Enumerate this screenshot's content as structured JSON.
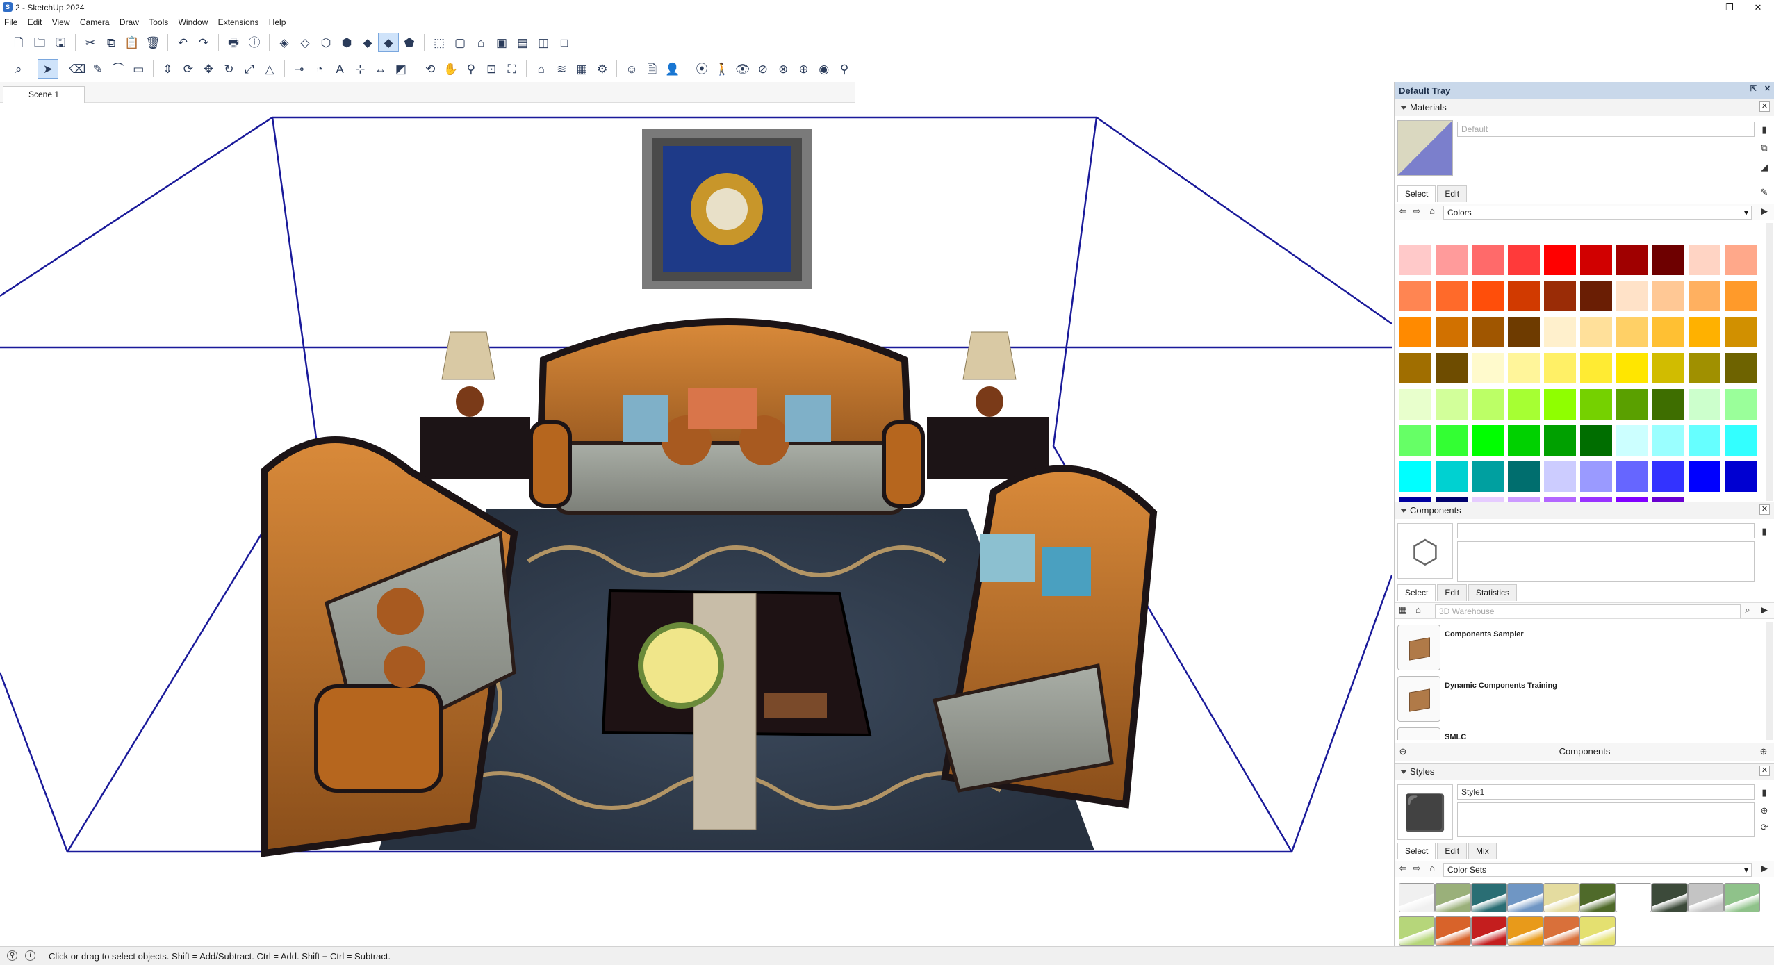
{
  "window": {
    "title": "2 - SketchUp 2024",
    "minimize": "—",
    "maximize": "❐",
    "close": "✕"
  },
  "menu": [
    "File",
    "Edit",
    "View",
    "Camera",
    "Draw",
    "Tools",
    "Window",
    "Extensions",
    "Help"
  ],
  "toolbar1": [
    {
      "name": "new-file-icon",
      "glyph": "🗋"
    },
    {
      "name": "open-icon",
      "glyph": "🗀"
    },
    {
      "name": "save-icon",
      "glyph": "🖫"
    },
    {
      "sep": true
    },
    {
      "name": "cut-icon",
      "glyph": "✂"
    },
    {
      "name": "copy-icon",
      "glyph": "⧉"
    },
    {
      "name": "paste-icon",
      "glyph": "📋"
    },
    {
      "name": "erase-icon",
      "glyph": "🗑"
    },
    {
      "sep": true
    },
    {
      "name": "undo-icon",
      "glyph": "↶"
    },
    {
      "name": "redo-icon",
      "glyph": "↷"
    },
    {
      "sep": true
    },
    {
      "name": "print-icon",
      "glyph": "🖶"
    },
    {
      "name": "model-info-icon",
      "glyph": "ⓘ"
    },
    {
      "sep": true
    },
    {
      "name": "xray-icon",
      "glyph": "◈"
    },
    {
      "name": "back-edges-icon",
      "glyph": "◇"
    },
    {
      "name": "wireframe-icon",
      "glyph": "⬡"
    },
    {
      "name": "hidden-line-icon",
      "glyph": "⬢"
    },
    {
      "name": "shaded-icon",
      "glyph": "◆"
    },
    {
      "name": "shaded-textures-icon",
      "glyph": "◆",
      "sel": true
    },
    {
      "name": "monochrome-icon",
      "glyph": "⬟"
    },
    {
      "sep": true
    },
    {
      "name": "iso-view-icon",
      "glyph": "⬚"
    },
    {
      "name": "top-view-icon",
      "glyph": "▢"
    },
    {
      "name": "front-view-icon",
      "glyph": "⌂"
    },
    {
      "name": "right-view-icon",
      "glyph": "▣"
    },
    {
      "name": "back-view-icon",
      "glyph": "▤"
    },
    {
      "name": "left-view-icon",
      "glyph": "◫"
    },
    {
      "name": "bottom-view-icon",
      "glyph": "□"
    }
  ],
  "toolbar2": [
    {
      "name": "search-icon",
      "glyph": "⌕"
    },
    {
      "sep": true
    },
    {
      "name": "select-tool-icon",
      "glyph": "➤",
      "sel": true
    },
    {
      "sep": true
    },
    {
      "name": "eraser-icon",
      "glyph": "⌫"
    },
    {
      "name": "line-tool-icon",
      "glyph": "✎"
    },
    {
      "name": "arc-tool-icon",
      "glyph": "⌒"
    },
    {
      "name": "rectangle-tool-icon",
      "glyph": "▭"
    },
    {
      "sep": true
    },
    {
      "name": "push-pull-icon",
      "glyph": "⇕"
    },
    {
      "name": "offset-icon",
      "glyph": "⟳"
    },
    {
      "name": "move-icon",
      "glyph": "✥"
    },
    {
      "name": "rotate-icon",
      "glyph": "↻"
    },
    {
      "name": "scale-icon",
      "glyph": "⤢"
    },
    {
      "name": "follow-me-icon",
      "glyph": "△"
    },
    {
      "sep": true
    },
    {
      "name": "tape-measure-icon",
      "glyph": "⊸"
    },
    {
      "name": "protractor-icon",
      "glyph": "◔"
    },
    {
      "name": "text-tool-icon",
      "glyph": "A"
    },
    {
      "name": "axes-icon",
      "glyph": "⊹"
    },
    {
      "name": "dimension-icon",
      "glyph": "↔"
    },
    {
      "name": "section-plane-icon",
      "glyph": "◩"
    },
    {
      "sep": true
    },
    {
      "name": "orbit-icon",
      "glyph": "⟲"
    },
    {
      "name": "pan-icon",
      "glyph": "✋"
    },
    {
      "name": "zoom-icon",
      "glyph": "⚲"
    },
    {
      "name": "zoom-window-icon",
      "glyph": "⊡"
    },
    {
      "name": "zoom-extents-icon",
      "glyph": "⛶"
    },
    {
      "sep": true
    },
    {
      "name": "3d-warehouse-icon",
      "glyph": "⌂"
    },
    {
      "name": "extension-warehouse-icon",
      "glyph": "≋"
    },
    {
      "name": "layout-icon",
      "glyph": "▦"
    },
    {
      "name": "trimble-connect-icon",
      "glyph": "⚙"
    },
    {
      "sep": true
    },
    {
      "name": "account-icon",
      "glyph": "☺"
    },
    {
      "name": "document-icon",
      "glyph": "🗎"
    },
    {
      "name": "user-icon",
      "glyph": "👤"
    },
    {
      "sep": true
    },
    {
      "name": "position-camera-icon",
      "glyph": "⦿"
    },
    {
      "name": "walk-icon",
      "glyph": "🚶"
    },
    {
      "name": "look-around-icon",
      "glyph": "👁"
    },
    {
      "name": "section-cut-icon",
      "glyph": "⊘"
    },
    {
      "name": "section-fill-icon",
      "glyph": "⊗"
    },
    {
      "name": "display-section-icon",
      "glyph": "⊕"
    },
    {
      "name": "eye-icon",
      "glyph": "◉"
    },
    {
      "name": "walk-person-icon",
      "glyph": "⚲"
    }
  ],
  "scene_tab": "Scene 1",
  "status": "Click or drag to select objects. Shift = Add/Subtract. Ctrl = Add. Shift + Ctrl = Subtract.",
  "tray": {
    "title": "Default Tray",
    "materials": {
      "header": "Materials",
      "name_placeholder": "Default",
      "tab_select": "Select",
      "tab_edit": "Edit",
      "library": "Colors",
      "colors": [
        "#ffc9c9",
        "#ff9b9b",
        "#ff6a6a",
        "#ff3a3a",
        "#ff0000",
        "#d10000",
        "#a00000",
        "#6e0000",
        "#ffd4c4",
        "#ffa88a",
        "#ff8552",
        "#ff6a2a",
        "#ff4e0a",
        "#d13a00",
        "#9a2c06",
        "#6a1e04",
        "#ffe2c8",
        "#ffc895",
        "#ffb060",
        "#ff9a2a",
        "#ff8a00",
        "#d17100",
        "#a05600",
        "#6e3b00",
        "#fff0cc",
        "#ffe09a",
        "#ffd066",
        "#ffc033",
        "#ffb100",
        "#d19000",
        "#a06e00",
        "#6e4c00",
        "#fffacc",
        "#fff59a",
        "#fff066",
        "#ffeb33",
        "#ffe600",
        "#d1bc00",
        "#a09000",
        "#6e6300",
        "#e8ffcc",
        "#d2ff9a",
        "#bcff66",
        "#a6ff33",
        "#8fff00",
        "#75d100",
        "#5aa000",
        "#3e6e00",
        "#ccffcc",
        "#9aff9a",
        "#66ff66",
        "#33ff33",
        "#00ff00",
        "#00d100",
        "#00a000",
        "#006e00",
        "#ccffff",
        "#9affff",
        "#66ffff",
        "#33ffff",
        "#00ffff",
        "#00d1d1",
        "#00a0a0",
        "#006e6e",
        "#ccccff",
        "#9a9aff",
        "#6666ff",
        "#3333ff",
        "#0000ff",
        "#0000d1",
        "#0000a0",
        "#00006e",
        "#e6ccff",
        "#cc9aff",
        "#b366ff",
        "#9933ff",
        "#8000ff",
        "#6900d1"
      ]
    },
    "components": {
      "header": "Components",
      "search_placeholder": "3D Warehouse",
      "tab_select": "Select",
      "tab_edit": "Edit",
      "tab_statistics": "Statistics",
      "items": [
        "Components Sampler",
        "Dynamic Components Training",
        "SMLC"
      ],
      "footer": "Components"
    },
    "styles": {
      "header": "Styles",
      "name": "Style1",
      "tab_select": "Select",
      "tab_edit": "Edit",
      "tab_mix": "Mix",
      "library": "Color Sets",
      "swatches": [
        "#f0f0f0",
        "#9ab07a",
        "#2a6e74",
        "#6f96c4",
        "#e4dca0",
        "#4f6a2a",
        "#ffffff",
        "#3c4a3a",
        "#c4c4c4",
        "#8fc28a",
        "#b6d67a",
        "#d8632a",
        "#c41e1e",
        "#e89a1a",
        "#d9703a",
        "#e4e070"
      ]
    }
  }
}
